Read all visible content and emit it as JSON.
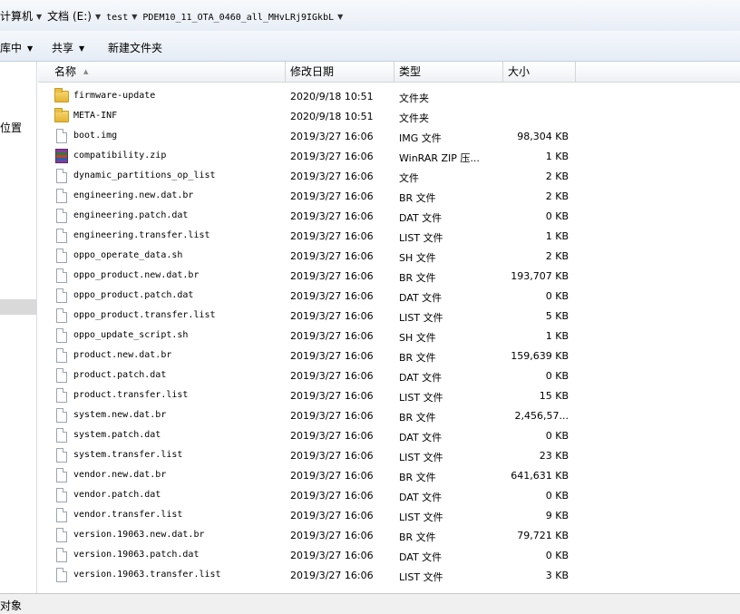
{
  "breadcrumb": [
    {
      "label": "计算机",
      "mono": false
    },
    {
      "label": "文档 (E:)",
      "mono": false
    },
    {
      "label": "test",
      "mono": true
    },
    {
      "label": "PDEM10_11_OTA_0460_all_MHvLRj9IGkbL",
      "mono": true
    }
  ],
  "toolbar": {
    "include_label": "库中",
    "share_label": "共享",
    "new_folder_label": "新建文件夹"
  },
  "nav": {
    "item_label": "位置"
  },
  "columns": {
    "name": "名称",
    "date": "修改日期",
    "type": "类型",
    "size": "大小"
  },
  "files": [
    {
      "name": "firmware-update",
      "date": "2020/9/18 10:51",
      "type": "文件夹",
      "size": "",
      "icon": "folder-icon"
    },
    {
      "name": "META-INF",
      "date": "2020/9/18 10:51",
      "type": "文件夹",
      "size": "",
      "icon": "folder-icon"
    },
    {
      "name": "boot.img",
      "date": "2019/3/27 16:06",
      "type": "IMG 文件",
      "size": "98,304 KB",
      "icon": "file-icon"
    },
    {
      "name": "compatibility.zip",
      "date": "2019/3/27 16:06",
      "type": "WinRAR ZIP 压...",
      "size": "1 KB",
      "icon": "winrar-zip-icon"
    },
    {
      "name": "dynamic_partitions_op_list",
      "date": "2019/3/27 16:06",
      "type": "文件",
      "size": "2 KB",
      "icon": "file-icon"
    },
    {
      "name": "engineering.new.dat.br",
      "date": "2019/3/27 16:06",
      "type": "BR 文件",
      "size": "2 KB",
      "icon": "file-icon"
    },
    {
      "name": "engineering.patch.dat",
      "date": "2019/3/27 16:06",
      "type": "DAT 文件",
      "size": "0 KB",
      "icon": "file-icon"
    },
    {
      "name": "engineering.transfer.list",
      "date": "2019/3/27 16:06",
      "type": "LIST 文件",
      "size": "1 KB",
      "icon": "file-icon"
    },
    {
      "name": "oppo_operate_data.sh",
      "date": "2019/3/27 16:06",
      "type": "SH 文件",
      "size": "2 KB",
      "icon": "file-icon"
    },
    {
      "name": "oppo_product.new.dat.br",
      "date": "2019/3/27 16:06",
      "type": "BR 文件",
      "size": "193,707 KB",
      "icon": "file-icon"
    },
    {
      "name": "oppo_product.patch.dat",
      "date": "2019/3/27 16:06",
      "type": "DAT 文件",
      "size": "0 KB",
      "icon": "file-icon"
    },
    {
      "name": "oppo_product.transfer.list",
      "date": "2019/3/27 16:06",
      "type": "LIST 文件",
      "size": "5 KB",
      "icon": "file-icon"
    },
    {
      "name": "oppo_update_script.sh",
      "date": "2019/3/27 16:06",
      "type": "SH 文件",
      "size": "1 KB",
      "icon": "file-icon"
    },
    {
      "name": "product.new.dat.br",
      "date": "2019/3/27 16:06",
      "type": "BR 文件",
      "size": "159,639 KB",
      "icon": "file-icon"
    },
    {
      "name": "product.patch.dat",
      "date": "2019/3/27 16:06",
      "type": "DAT 文件",
      "size": "0 KB",
      "icon": "file-icon"
    },
    {
      "name": "product.transfer.list",
      "date": "2019/3/27 16:06",
      "type": "LIST 文件",
      "size": "15 KB",
      "icon": "file-icon"
    },
    {
      "name": "system.new.dat.br",
      "date": "2019/3/27 16:06",
      "type": "BR 文件",
      "size": "2,456,57...",
      "icon": "file-icon"
    },
    {
      "name": "system.patch.dat",
      "date": "2019/3/27 16:06",
      "type": "DAT 文件",
      "size": "0 KB",
      "icon": "file-icon"
    },
    {
      "name": "system.transfer.list",
      "date": "2019/3/27 16:06",
      "type": "LIST 文件",
      "size": "23 KB",
      "icon": "file-icon"
    },
    {
      "name": "vendor.new.dat.br",
      "date": "2019/3/27 16:06",
      "type": "BR 文件",
      "size": "641,631 KB",
      "icon": "file-icon"
    },
    {
      "name": "vendor.patch.dat",
      "date": "2019/3/27 16:06",
      "type": "DAT 文件",
      "size": "0 KB",
      "icon": "file-icon"
    },
    {
      "name": "vendor.transfer.list",
      "date": "2019/3/27 16:06",
      "type": "LIST 文件",
      "size": "9 KB",
      "icon": "file-icon"
    },
    {
      "name": "version.19063.new.dat.br",
      "date": "2019/3/27 16:06",
      "type": "BR 文件",
      "size": "79,721 KB",
      "icon": "file-icon"
    },
    {
      "name": "version.19063.patch.dat",
      "date": "2019/3/27 16:06",
      "type": "DAT 文件",
      "size": "0 KB",
      "icon": "file-icon"
    },
    {
      "name": "version.19063.transfer.list",
      "date": "2019/3/27 16:06",
      "type": "LIST 文件",
      "size": "3 KB",
      "icon": "file-icon"
    }
  ],
  "status": {
    "text": "对象"
  }
}
